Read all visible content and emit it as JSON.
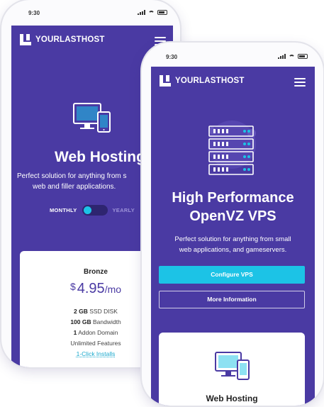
{
  "back_phone": {
    "time": "9:30",
    "brand": "YOURLASTHOST",
    "title": "Web Hosting",
    "subtitle": "Perfect solution for anything from s web and filler applications.",
    "subtitle_line1": "Perfect solution for anything from s",
    "subtitle_line2": "web and filler applications.",
    "toggle_monthly": "MONTHLY",
    "toggle_yearly": "YEARLY",
    "plan": {
      "name": "Bronze",
      "currency": "$",
      "price": "4.95",
      "period": "/mo",
      "features": [
        {
          "bold": "2 GB",
          "text": " SSD DISK"
        },
        {
          "bold": "100 GB",
          "text": " Bandwidth"
        },
        {
          "bold": "1",
          "text": " Addon Domain"
        },
        {
          "bold": "",
          "text": "Unlimited Features"
        }
      ],
      "link": "1-Click Installs"
    }
  },
  "front_phone": {
    "time": "9:30",
    "brand": "YOURLASTHOST",
    "title_line1": "High Performance",
    "title_line2": "OpenVZ VPS",
    "subtitle_line1": "Perfect solution for anything from small",
    "subtitle_line2": "web applications, and gameservers.",
    "primary_button": "Configure VPS",
    "secondary_button": "More Information",
    "card_title": "Web Hosting"
  },
  "colors": {
    "brand_purple": "#4a3aa3",
    "accent_cyan": "#1cc3e6",
    "background": "#ffffff"
  }
}
